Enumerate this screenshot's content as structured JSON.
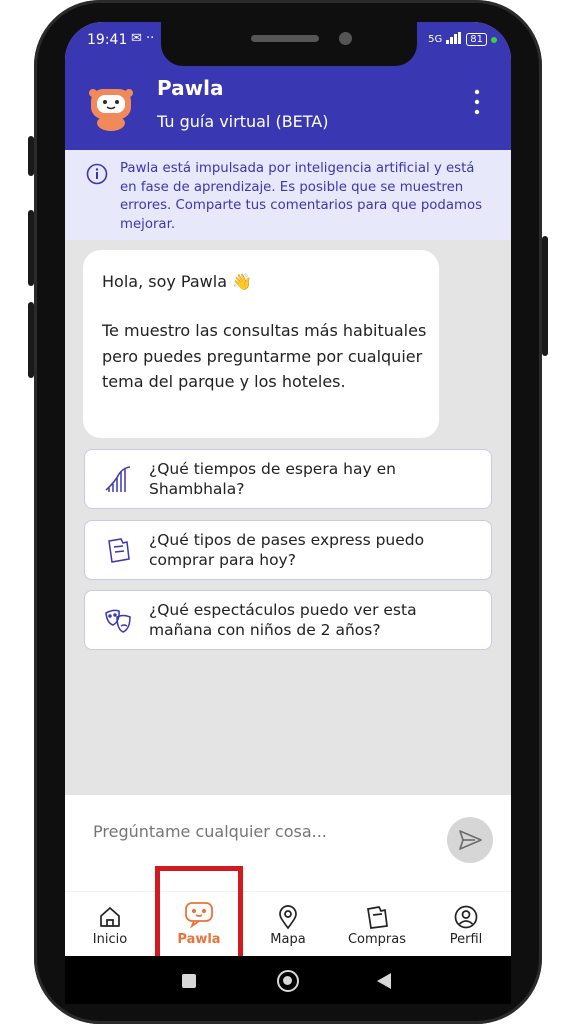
{
  "status_bar": {
    "time": "19:41",
    "signal": "5G",
    "battery": "81"
  },
  "header": {
    "title": "Pawla",
    "subtitle": "Tu guía virtual (BETA)"
  },
  "banner": {
    "text": "Pawla está impulsada por inteligencia artificial y está en fase de aprendizaje. Es posible que se muestren errores. Comparte tus comentarios para que podamos mejorar."
  },
  "chat": {
    "greeting": "Hola, soy Pawla 👋",
    "body": "Te muestro las consultas más habituales pero puedes preguntarme por cualquier tema del parque y los hoteles."
  },
  "suggestions": [
    {
      "text": "¿Qué tiempos de espera hay en Shambhala?",
      "icon": "rollercoaster-icon"
    },
    {
      "text": "¿Qué tipos de pases express puedo comprar para hoy?",
      "icon": "ticket-icon"
    },
    {
      "text": "¿Qué espectáculos puedo ver esta mañana con niños de 2 años?",
      "icon": "theater-masks-icon"
    }
  ],
  "input": {
    "placeholder": "Pregúntame cualquier cosa..."
  },
  "nav": [
    {
      "label": "Inicio",
      "icon": "home-icon"
    },
    {
      "label": "Pawla",
      "icon": "pawla-chat-icon"
    },
    {
      "label": "Mapa",
      "icon": "map-pin-icon"
    },
    {
      "label": "Compras",
      "icon": "tickets-icon"
    },
    {
      "label": "Perfil",
      "icon": "profile-icon"
    }
  ],
  "colors": {
    "brand": "#3a37b2",
    "accent": "#e8743b",
    "highlight": "#d21b21"
  }
}
